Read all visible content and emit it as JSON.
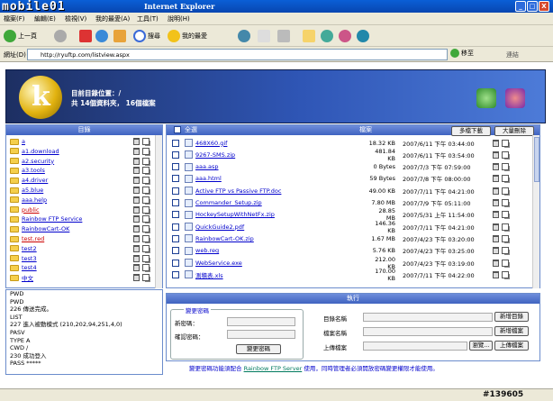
{
  "window": {
    "title": "Internet Explorer",
    "watermark": "mobile01",
    "min": "_",
    "max": "□",
    "close": "X"
  },
  "menu": [
    "檔案(F)",
    "編輯(E)",
    "檢視(V)",
    "我的最愛(A)",
    "工具(T)",
    "說明(H)"
  ],
  "toolbar": {
    "back": "上一頁",
    "search": "搜尋",
    "favorites": "我的最愛"
  },
  "address": {
    "label": "網址(D)",
    "url": "http://ryuftp.com/listview.aspx",
    "go": "移至",
    "links": "連結"
  },
  "header": {
    "dir": "目前目錄位置：/",
    "count": "共 14個資料夾， 16個檔案"
  },
  "left": {
    "title": "目錄",
    "folders": [
      {
        "name": "a",
        "red": false
      },
      {
        "name": "a1.download",
        "red": false
      },
      {
        "name": "a2.security",
        "red": false
      },
      {
        "name": "a3.tools",
        "red": false
      },
      {
        "name": "a4.driver",
        "red": false
      },
      {
        "name": "a5.blue",
        "red": false
      },
      {
        "name": "aaa.help",
        "red": false
      },
      {
        "name": "public",
        "red": true
      },
      {
        "name": "Rainbow FTP Service",
        "red": false
      },
      {
        "name": "RainbowCart-OK",
        "red": false
      },
      {
        "name": "test.red",
        "red": true
      },
      {
        "name": "test2",
        "red": false
      },
      {
        "name": "test3",
        "red": false
      },
      {
        "name": "test4",
        "red": false
      },
      {
        "name": "中文",
        "red": false
      }
    ]
  },
  "log": [
    "PWD",
    "PWD",
    "226 傳送完成。",
    "LIST",
    "227 進入被動模式 (210,202,94,251,4,0)",
    "PASV",
    "TYPE A",
    "CWD /",
    "230 成功登入",
    "PASS *****"
  ],
  "right": {
    "selectall": "全選",
    "title": "檔案",
    "multi_download": "多檔下載",
    "batch_delete": "大量刪除",
    "files": [
      {
        "name": "468X60.gif",
        "size": "18.32 KB",
        "date": "2007/6/11 下午 03:44:00"
      },
      {
        "name": "9267-SMS.zip",
        "size": "481.84 KB",
        "date": "2007/6/11 下午 03:54:00"
      },
      {
        "name": "aaa.asp",
        "size": "0 Bytes",
        "date": "2007/7/3 下午 07:59:00"
      },
      {
        "name": "aaa.html",
        "size": "59 Bytes",
        "date": "2007/7/8 下午 08:00:00"
      },
      {
        "name": "Active FTP vs Passive FTP.doc",
        "size": "49.00 KB",
        "date": "2007/7/11 下午 04:21:00"
      },
      {
        "name": "Commander_Setup.zip",
        "size": "7.80 MB",
        "date": "2007/7/9 下午 05:11:00"
      },
      {
        "name": "HockeySetupWithNetFx.zip",
        "size": "28.85 MB",
        "date": "2007/5/31 上午 11:54:00"
      },
      {
        "name": "QuickGuide2.pdf",
        "size": "146.36 KB",
        "date": "2007/7/11 下午 04:21:00"
      },
      {
        "name": "RainbowCart-OK.zip",
        "size": "1.67 MB",
        "date": "2007/4/23 下午 03:20:00"
      },
      {
        "name": "web.reg",
        "size": "5.76 KB",
        "date": "2007/4/23 下午 03:25:00"
      },
      {
        "name": "WebService.exe",
        "size": "212.00 KB",
        "date": "2007/4/23 下午 03:19:00"
      },
      {
        "name": "測積表.xls",
        "size": "170.00 KB",
        "date": "2007/7/11 下午 04:22:00"
      }
    ]
  },
  "exec": {
    "title": "執行",
    "pw_legend": "變更密碼",
    "new_pw": "新密碼：",
    "confirm_pw": "確認密碼：",
    "change_pw": "變更密碼",
    "dir_name": "目錄名稱",
    "file_name": "檔案名稱",
    "upload": "上傳檔案",
    "new_dir": "新增目錄",
    "new_file": "新增檔案",
    "browse": "瀏覽...",
    "upload_btn": "上傳檔案"
  },
  "note": {
    "pre": "變更密碼功能須配合 ",
    "link": "Rainbow FTP Server",
    "post": " 使用，同時管理者必須開放密碼變更權限才能使用。"
  },
  "status": {
    "right": "#139605"
  }
}
